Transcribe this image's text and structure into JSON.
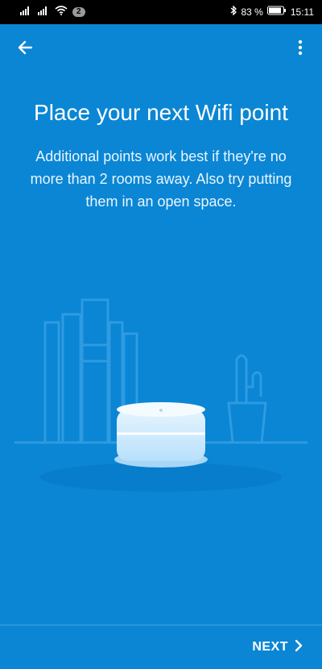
{
  "status_bar": {
    "sim_badge": "2",
    "battery_percent": "83 %",
    "time": "15:11",
    "icons": [
      "signal-icon",
      "signal-icon-2",
      "wifi-icon",
      "bluetooth-icon",
      "battery-icon"
    ]
  },
  "app_bar": {
    "back_icon": "arrow-left-icon",
    "menu_icon": "more-vertical-icon"
  },
  "content": {
    "title": "Place your next Wifi point",
    "description": "Additional points work best if they're no more than 2 rooms away. Also try putting them in an open space."
  },
  "footer": {
    "next_label": "NEXT",
    "next_icon": "chevron-right-icon"
  },
  "colors": {
    "background": "#0a86d4",
    "status_bar": "#000000",
    "text": "#ffffff"
  }
}
